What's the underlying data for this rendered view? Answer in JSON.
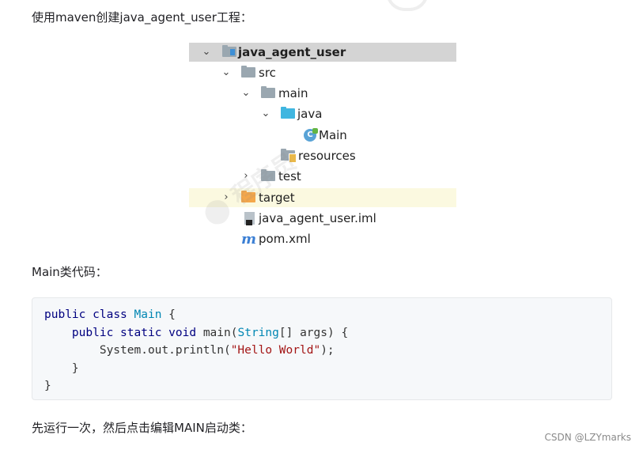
{
  "paragraphs": {
    "intro": "使用maven创建java_agent_user工程：",
    "main_code_label": "Main类代码：",
    "run_instruction": "先运行一次，然后点击编辑MAIN启动类："
  },
  "tree": {
    "items": [
      {
        "label": "java_agent_user",
        "icon": "project-folder-icon",
        "expanded": true,
        "selected": true
      },
      {
        "label": "src",
        "icon": "folder-icon",
        "expanded": true
      },
      {
        "label": "main",
        "icon": "folder-icon",
        "expanded": true
      },
      {
        "label": "java",
        "icon": "source-folder-icon",
        "expanded": true
      },
      {
        "label": "Main",
        "icon": "java-class-icon"
      },
      {
        "label": "resources",
        "icon": "resources-folder-icon"
      },
      {
        "label": "test",
        "icon": "folder-icon",
        "expanded": false
      },
      {
        "label": "target",
        "icon": "excluded-folder-icon",
        "expanded": false,
        "highlighted": true
      },
      {
        "label": "java_agent_user.iml",
        "icon": "iml-file-icon"
      },
      {
        "label": "pom.xml",
        "icon": "maven-icon"
      }
    ],
    "chevron_expanded": "⌄",
    "chevron_collapsed": "›"
  },
  "code": {
    "language": "java",
    "lines": [
      "public class Main {",
      "    public static void main(String[] args) {",
      "        System.out.println(\"Hello World\");",
      "    }",
      "}"
    ]
  },
  "credit": "CSDN @LZYmarks",
  "colors": {
    "selection": "#d4d4d4",
    "highlight": "#fbf9e0",
    "folder": "#9aa7b0",
    "source_folder": "#40b6e0",
    "excluded_folder": "#f4a74b",
    "code_bg": "#f6f8fa"
  }
}
